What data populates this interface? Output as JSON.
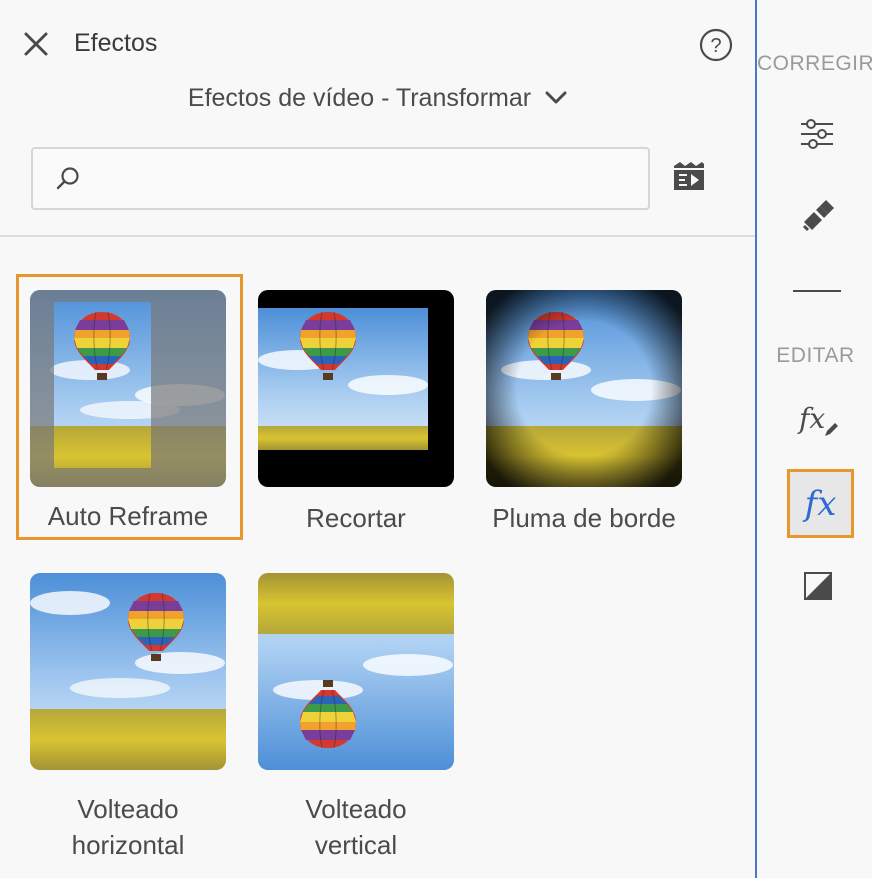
{
  "header": {
    "title": "Efectos",
    "category": "Efectos de vídeo - Transformar"
  },
  "search": {
    "value": "",
    "placeholder": ""
  },
  "effects": [
    {
      "label": "Auto Reframe",
      "selected": true
    },
    {
      "label": "Recortar",
      "selected": false
    },
    {
      "label": "Pluma de borde",
      "selected": false
    },
    {
      "label_line1": "Volteado",
      "label_line2": "horizontal",
      "selected": false
    },
    {
      "label_line1": "Volteado",
      "label_line2": "vertical",
      "selected": false
    }
  ],
  "rail": {
    "correct_heading": "CORREGIR",
    "edit_heading": "EDITAR",
    "fx_label": "fx",
    "fx_label_active": "fx"
  },
  "colors": {
    "accent": "#e8972e",
    "rail_border": "#4a78c9",
    "fx_active": "#2d6ad2",
    "sky": "#7fb1e6",
    "field": "#c8b52a"
  },
  "icons": {
    "close": "close-icon",
    "help": "help-icon",
    "chevron": "chevron-down-icon",
    "search": "search-icon",
    "apply": "apply-to-clip-icon",
    "adjust": "sliders-icon",
    "healing": "healing-icon",
    "fx_edit": "fx-edit-icon",
    "fx_active": "fx-icon",
    "contrast": "contrast-icon"
  }
}
